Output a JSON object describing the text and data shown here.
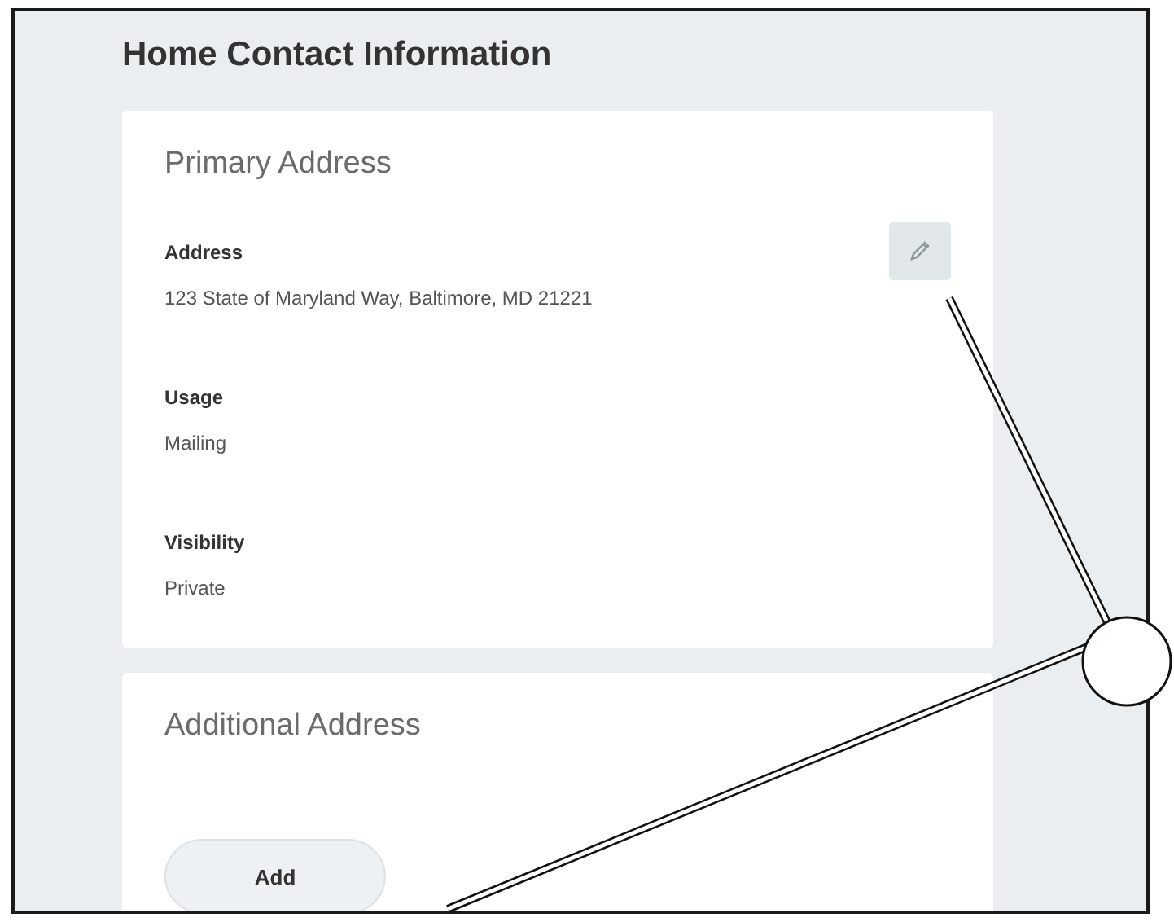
{
  "page": {
    "title": "Home Contact Information"
  },
  "sections": [
    {
      "title": "Primary Address",
      "editable": true,
      "fields": [
        {
          "label": "Address",
          "value": "123 State of Maryland Way, Baltimore, MD 21221"
        },
        {
          "label": "Usage",
          "value": "Mailing"
        },
        {
          "label": "Visibility",
          "value": "Private"
        }
      ]
    },
    {
      "title": "Additional Address",
      "buttons": [
        "Add"
      ]
    }
  ]
}
